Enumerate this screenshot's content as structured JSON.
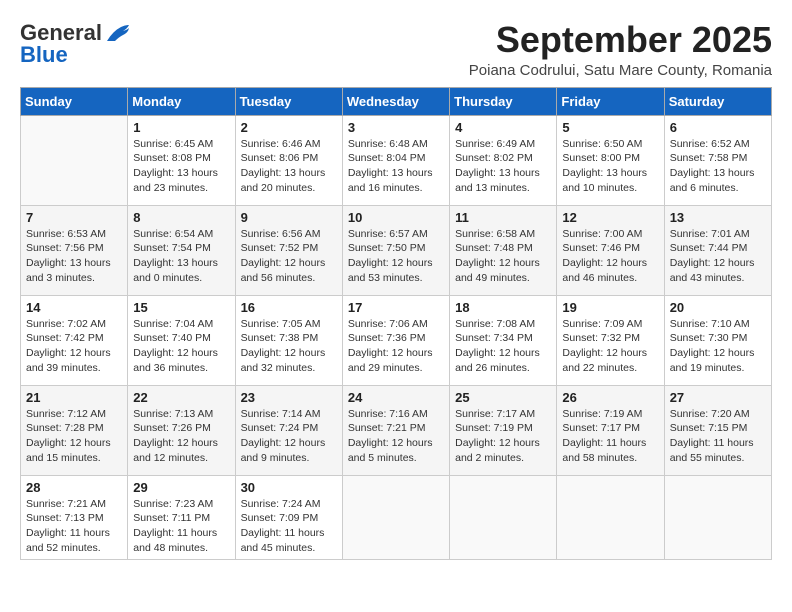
{
  "logo": {
    "general": "General",
    "blue": "Blue"
  },
  "title": "September 2025",
  "location": "Poiana Codrului, Satu Mare County, Romania",
  "days_of_week": [
    "Sunday",
    "Monday",
    "Tuesday",
    "Wednesday",
    "Thursday",
    "Friday",
    "Saturday"
  ],
  "weeks": [
    [
      {
        "day": "",
        "info": ""
      },
      {
        "day": "1",
        "info": "Sunrise: 6:45 AM\nSunset: 8:08 PM\nDaylight: 13 hours\nand 23 minutes."
      },
      {
        "day": "2",
        "info": "Sunrise: 6:46 AM\nSunset: 8:06 PM\nDaylight: 13 hours\nand 20 minutes."
      },
      {
        "day": "3",
        "info": "Sunrise: 6:48 AM\nSunset: 8:04 PM\nDaylight: 13 hours\nand 16 minutes."
      },
      {
        "day": "4",
        "info": "Sunrise: 6:49 AM\nSunset: 8:02 PM\nDaylight: 13 hours\nand 13 minutes."
      },
      {
        "day": "5",
        "info": "Sunrise: 6:50 AM\nSunset: 8:00 PM\nDaylight: 13 hours\nand 10 minutes."
      },
      {
        "day": "6",
        "info": "Sunrise: 6:52 AM\nSunset: 7:58 PM\nDaylight: 13 hours\nand 6 minutes."
      }
    ],
    [
      {
        "day": "7",
        "info": "Sunrise: 6:53 AM\nSunset: 7:56 PM\nDaylight: 13 hours\nand 3 minutes."
      },
      {
        "day": "8",
        "info": "Sunrise: 6:54 AM\nSunset: 7:54 PM\nDaylight: 13 hours\nand 0 minutes."
      },
      {
        "day": "9",
        "info": "Sunrise: 6:56 AM\nSunset: 7:52 PM\nDaylight: 12 hours\nand 56 minutes."
      },
      {
        "day": "10",
        "info": "Sunrise: 6:57 AM\nSunset: 7:50 PM\nDaylight: 12 hours\nand 53 minutes."
      },
      {
        "day": "11",
        "info": "Sunrise: 6:58 AM\nSunset: 7:48 PM\nDaylight: 12 hours\nand 49 minutes."
      },
      {
        "day": "12",
        "info": "Sunrise: 7:00 AM\nSunset: 7:46 PM\nDaylight: 12 hours\nand 46 minutes."
      },
      {
        "day": "13",
        "info": "Sunrise: 7:01 AM\nSunset: 7:44 PM\nDaylight: 12 hours\nand 43 minutes."
      }
    ],
    [
      {
        "day": "14",
        "info": "Sunrise: 7:02 AM\nSunset: 7:42 PM\nDaylight: 12 hours\nand 39 minutes."
      },
      {
        "day": "15",
        "info": "Sunrise: 7:04 AM\nSunset: 7:40 PM\nDaylight: 12 hours\nand 36 minutes."
      },
      {
        "day": "16",
        "info": "Sunrise: 7:05 AM\nSunset: 7:38 PM\nDaylight: 12 hours\nand 32 minutes."
      },
      {
        "day": "17",
        "info": "Sunrise: 7:06 AM\nSunset: 7:36 PM\nDaylight: 12 hours\nand 29 minutes."
      },
      {
        "day": "18",
        "info": "Sunrise: 7:08 AM\nSunset: 7:34 PM\nDaylight: 12 hours\nand 26 minutes."
      },
      {
        "day": "19",
        "info": "Sunrise: 7:09 AM\nSunset: 7:32 PM\nDaylight: 12 hours\nand 22 minutes."
      },
      {
        "day": "20",
        "info": "Sunrise: 7:10 AM\nSunset: 7:30 PM\nDaylight: 12 hours\nand 19 minutes."
      }
    ],
    [
      {
        "day": "21",
        "info": "Sunrise: 7:12 AM\nSunset: 7:28 PM\nDaylight: 12 hours\nand 15 minutes."
      },
      {
        "day": "22",
        "info": "Sunrise: 7:13 AM\nSunset: 7:26 PM\nDaylight: 12 hours\nand 12 minutes."
      },
      {
        "day": "23",
        "info": "Sunrise: 7:14 AM\nSunset: 7:24 PM\nDaylight: 12 hours\nand 9 minutes."
      },
      {
        "day": "24",
        "info": "Sunrise: 7:16 AM\nSunset: 7:21 PM\nDaylight: 12 hours\nand 5 minutes."
      },
      {
        "day": "25",
        "info": "Sunrise: 7:17 AM\nSunset: 7:19 PM\nDaylight: 12 hours\nand 2 minutes."
      },
      {
        "day": "26",
        "info": "Sunrise: 7:19 AM\nSunset: 7:17 PM\nDaylight: 11 hours\nand 58 minutes."
      },
      {
        "day": "27",
        "info": "Sunrise: 7:20 AM\nSunset: 7:15 PM\nDaylight: 11 hours\nand 55 minutes."
      }
    ],
    [
      {
        "day": "28",
        "info": "Sunrise: 7:21 AM\nSunset: 7:13 PM\nDaylight: 11 hours\nand 52 minutes."
      },
      {
        "day": "29",
        "info": "Sunrise: 7:23 AM\nSunset: 7:11 PM\nDaylight: 11 hours\nand 48 minutes."
      },
      {
        "day": "30",
        "info": "Sunrise: 7:24 AM\nSunset: 7:09 PM\nDaylight: 11 hours\nand 45 minutes."
      },
      {
        "day": "",
        "info": ""
      },
      {
        "day": "",
        "info": ""
      },
      {
        "day": "",
        "info": ""
      },
      {
        "day": "",
        "info": ""
      }
    ]
  ]
}
